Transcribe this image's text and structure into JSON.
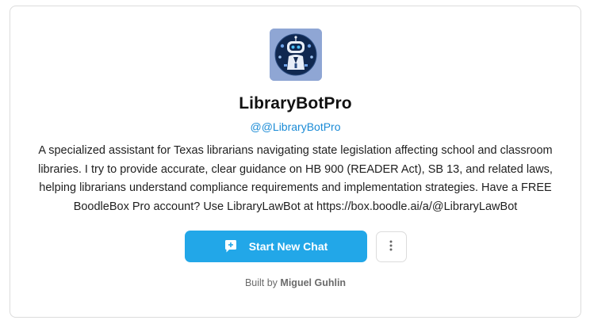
{
  "bot": {
    "name": "LibraryBotPro",
    "handle": "@@LibraryBotPro",
    "description": "A specialized assistant for Texas librarians navigating state legislation affecting school and classroom libraries. I try to provide accurate, clear guidance on HB 900 (READER Act), SB 13, and related laws, helping librarians understand compliance requirements and implementation strategies. Have a FREE BoodleBox Pro account? Use LibraryLawBot at https://box.boodle.ai/a/@LibraryLawBot",
    "avatar_icon": "robot-avatar-icon"
  },
  "actions": {
    "start_chat_label": "Start New Chat",
    "start_chat_icon": "chat-plus-icon",
    "more_icon": "more-vertical-icon"
  },
  "footer": {
    "built_by_prefix": "Built by",
    "author": "Miguel Guhlin"
  },
  "colors": {
    "accent": "#22a7e8",
    "handle": "#1a8bd6",
    "avatar_bg": "#8fa6d4"
  }
}
